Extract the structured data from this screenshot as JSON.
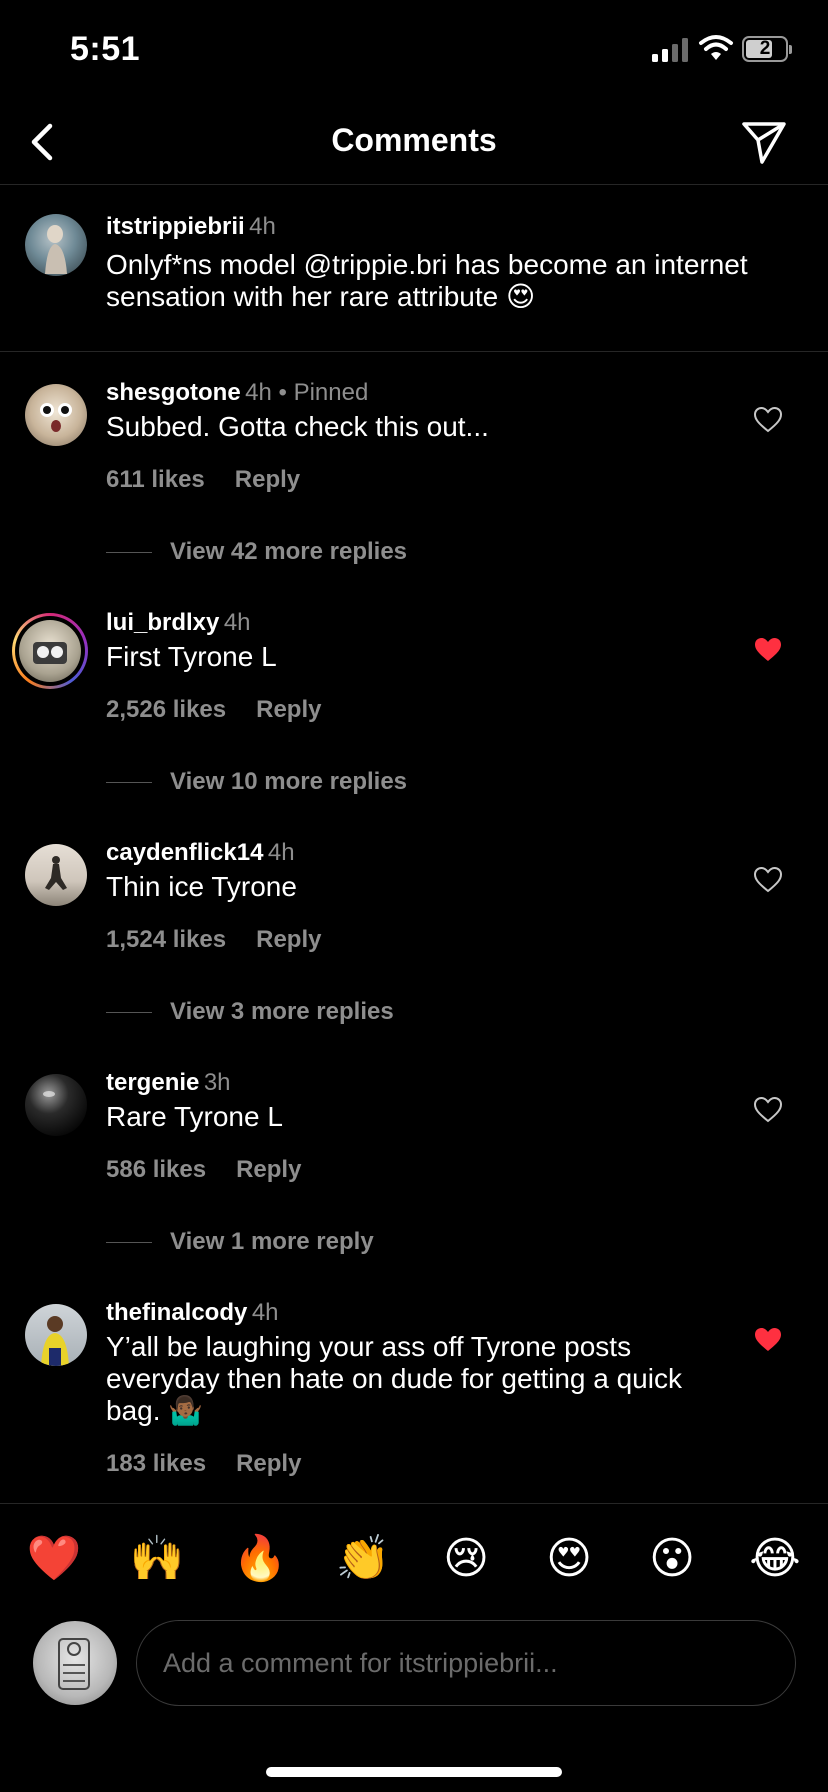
{
  "status": {
    "time": "5:51",
    "battery": "2"
  },
  "header": {
    "title": "Comments"
  },
  "caption": {
    "username": "itstrippiebrii",
    "time": "4h",
    "text": "Onlyf*ns model @trippie.bri has become an internet sensation with her rare attribute 😍"
  },
  "comments": [
    {
      "username": "shesgotone",
      "time": "4h",
      "pinned": " • Pinned",
      "text": "Subbed. Gotta check this out...",
      "likes": "611 likes",
      "reply": "Reply",
      "view_more": "View 42 more replies",
      "liked": false
    },
    {
      "username": "lui_brdlxy",
      "time": "4h",
      "pinned": "",
      "text": "First Tyrone L",
      "likes": "2,526 likes",
      "reply": "Reply",
      "view_more": "View 10 more replies",
      "liked": true
    },
    {
      "username": "caydenflick14",
      "time": "4h",
      "pinned": "",
      "text": "Thin ice Tyrone",
      "likes": "1,524 likes",
      "reply": "Reply",
      "view_more": "View 3 more replies",
      "liked": false
    },
    {
      "username": "tergenie",
      "time": "3h",
      "pinned": "",
      "text": "Rare Tyrone L",
      "likes": "586 likes",
      "reply": "Reply",
      "view_more": "View 1 more reply",
      "liked": false
    },
    {
      "username": "thefinalcody",
      "time": "4h",
      "pinned": "",
      "text": "Y’all be laughing your ass off Tyrone posts everyday then hate on dude for getting a quick bag. 🤷🏾‍♂️",
      "likes": "183 likes",
      "reply": "Reply",
      "view_more": "",
      "liked": true
    }
  ],
  "emojis": [
    "❤️",
    "🙌",
    "🔥",
    "👏",
    "😢",
    "😍",
    "😮",
    "😂"
  ],
  "composer": {
    "placeholder": "Add a comment for itstrippiebrii..."
  },
  "colors": {
    "background": "#000000",
    "muted": "#8e8e8e",
    "liked_heart": "#ff3040",
    "divider": "#262626"
  }
}
